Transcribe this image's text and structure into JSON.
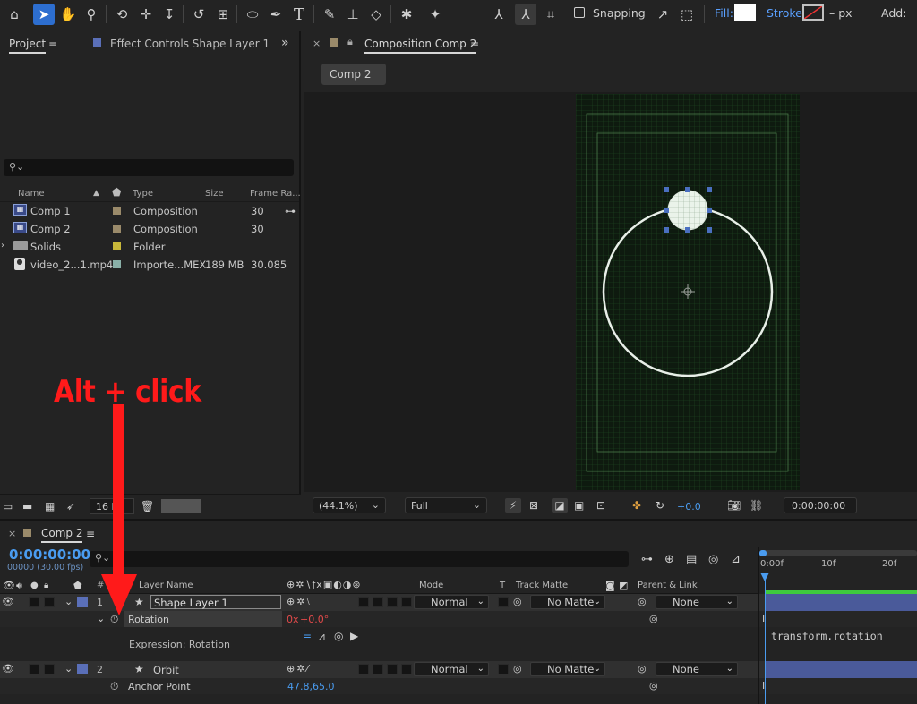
{
  "toolbar": {
    "snapping_label": "Snapping",
    "fill_label": "Fill:",
    "stroke_label": "Stroke:",
    "stroke_units": "– px",
    "add_label": "Add:"
  },
  "project_panel": {
    "tab_project": "Project",
    "tab_effect_controls": "Effect Controls Shape Layer 1",
    "columns": [
      "Name",
      "Type",
      "Size",
      "Frame Ra..."
    ],
    "items": [
      {
        "name": "Comp 1",
        "type": "Composition",
        "size": "",
        "fps": "30",
        "swatch": "#9a8a6a"
      },
      {
        "name": "Comp 2",
        "type": "Composition",
        "size": "",
        "fps": "30",
        "swatch": "#9a8a6a"
      },
      {
        "name": "Solids",
        "type": "Folder",
        "size": "",
        "fps": "",
        "swatch": "#c8b83a"
      },
      {
        "name": "video_2...1.mp4",
        "type": "Importe...MEX",
        "size": "189 MB",
        "fps": "30.085",
        "swatch": "#8ab0a8"
      }
    ],
    "bpc": "16 b"
  },
  "comp_panel": {
    "tab_title": "Composition Comp 2",
    "sub_tab": "Comp 2",
    "zoom": "(44.1%)",
    "resolution": "Full",
    "exposure": "+0.0",
    "timecode": "0:00:00:00"
  },
  "annotation": {
    "text": "Alt + click"
  },
  "timeline": {
    "tab_title": "Comp 2",
    "current_time": "0:00:00:00",
    "frame_info": "00000 (30.00 fps)",
    "col_num": "#",
    "col_layer_name": "Layer Name",
    "col_mode": "Mode",
    "col_t": "T",
    "col_track_matte": "Track Matte",
    "col_parent": "Parent & Link",
    "ruler": [
      "0:00f",
      "10f",
      "20f"
    ],
    "layers": [
      {
        "num": "1",
        "name": "Shape Layer 1",
        "mode": "Normal",
        "matte": "No Matte",
        "parent": "None"
      },
      {
        "num": "2",
        "name": "Orbit",
        "mode": "Normal",
        "matte": "No Matte",
        "parent": "None"
      }
    ],
    "rotation_label": "Rotation",
    "rotation_value_a": "0x",
    "rotation_value_b": "+0.0°",
    "expression_label": "Expression: Rotation",
    "expression_text": "transform.rotation",
    "anchor_label": "Anchor Point",
    "anchor_value": "47.8,65.0"
  },
  "colors": {
    "accent_blue": "#2d6ecf",
    "layer_label": "#5a6fb8",
    "annotation_red": "#ff1a1a"
  }
}
